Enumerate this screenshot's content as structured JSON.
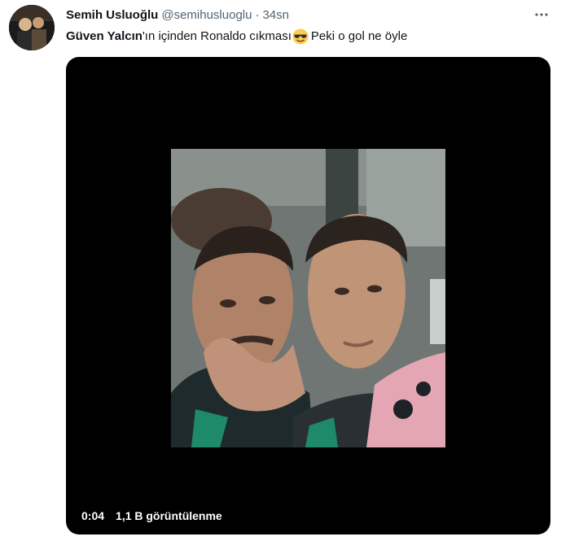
{
  "tweet": {
    "author_name": "Semih Usluoğlu",
    "author_handle": "@semihusluoglu",
    "separator": "·",
    "time": "34sn",
    "mention": "Güven Yalcın",
    "text_before_emoji": "'ın içinden Ronaldo cıkması",
    "emoji_icon": "smiling-face-with-sunglasses-icon",
    "text_after_emoji": "Peki o gol ne öyle",
    "more_icon": "more-horizontal-icon"
  },
  "media": {
    "type": "video",
    "elapsed": "0:04",
    "views": "1,1 B görüntülenme"
  }
}
